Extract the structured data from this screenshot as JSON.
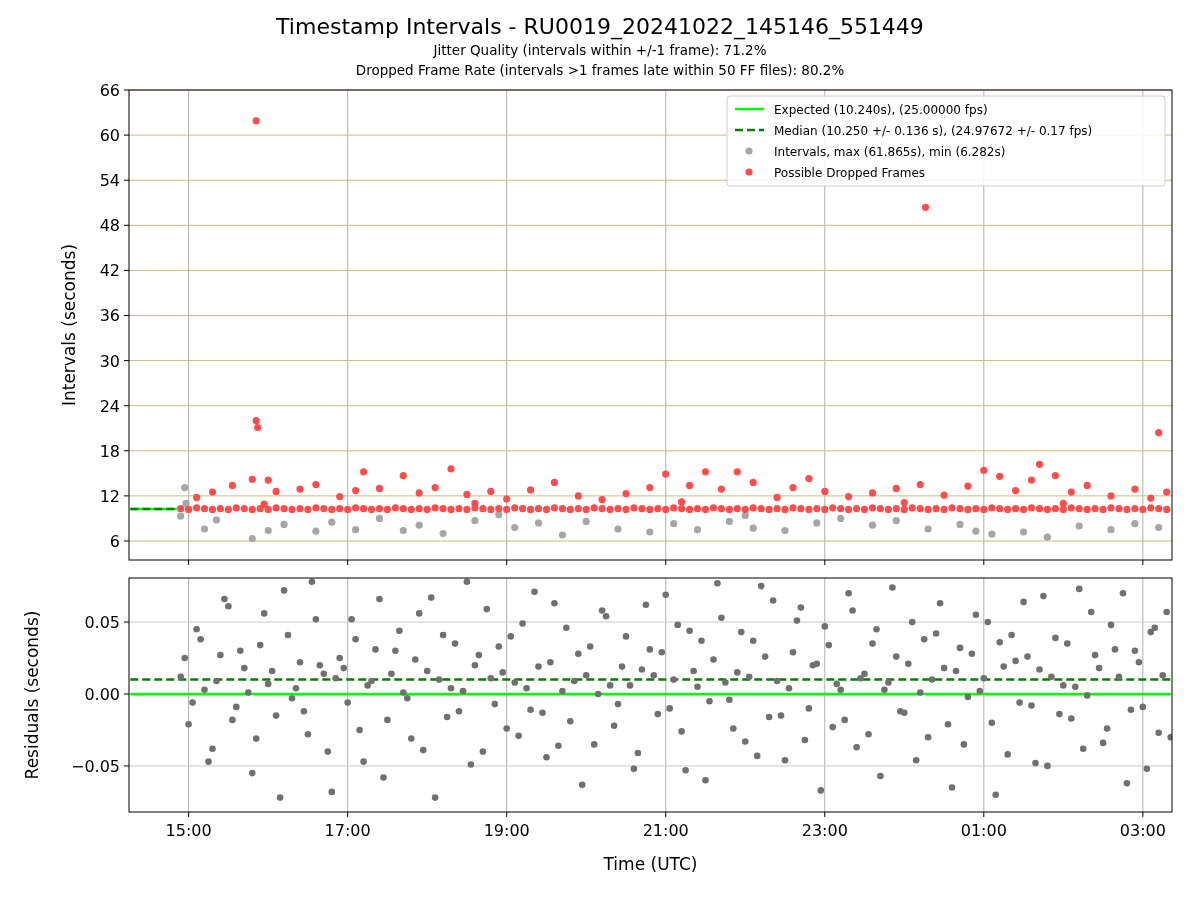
{
  "figure": {
    "title": "Timestamp Intervals - RU0019_20241022_145146_551449",
    "subtitles": [
      "Jitter Quality (intervals within +/-1 frame): 71.2%",
      "Dropped Frame Rate (intervals >1 frames late within 50 FF files): 80.2%"
    ]
  },
  "panels": [
    {
      "chart_data": {
        "type": "scatter",
        "ylabel": "Intervals (seconds)",
        "grid": true,
        "legend": true,
        "xlim": [
          "2024-10-22T14:15",
          "2024-10-23T03:22"
        ],
        "ylim": [
          3.47,
          66
        ],
        "yticks": [
          6,
          12,
          18,
          24,
          30,
          36,
          42,
          48,
          54,
          60,
          66
        ],
        "series": [
          {
            "name": "Expected (10.240s), (25.00000 fps)",
            "type": "line",
            "color": "#00ff00",
            "x": [
              "2024-10-22T14:16",
              "2024-10-22T14:51"
            ],
            "values": [
              10.24,
              10.24
            ]
          },
          {
            "name": "Median (10.250 +/- 0.136 s), (24.97672 +/- 0.17 fps)",
            "type": "line",
            "line_style": "dashed",
            "color": "#008000",
            "x": [
              "2024-10-22T14:16",
              "2024-10-22T14:51"
            ],
            "values": [
              10.25,
              10.25
            ]
          },
          {
            "name": "Intervals, max (61.865s), min (6.282s)",
            "color": "#a6a6a6",
            "x": [
              "2024-10-22T14:54",
              "2024-10-22T14:57",
              "2024-10-22T14:58",
              "2024-10-22T15:12",
              "2024-10-22T15:21",
              "2024-10-22T15:48",
              "2024-10-22T16:00",
              "2024-10-22T16:12",
              "2024-10-22T16:36",
              "2024-10-22T16:48",
              "2024-10-22T17:06",
              "2024-10-22T17:24",
              "2024-10-22T17:42",
              "2024-10-22T17:54",
              "2024-10-22T18:12",
              "2024-10-22T18:36",
              "2024-10-22T19:06",
              "2024-10-22T19:24",
              "2024-10-22T19:42",
              "2024-10-22T20:00",
              "2024-10-22T20:24",
              "2024-10-22T20:48",
              "2024-10-22T21:06",
              "2024-10-22T21:24",
              "2024-10-22T21:48",
              "2024-10-22T22:06",
              "2024-10-22T22:30",
              "2024-10-22T22:54",
              "2024-10-22T23:12",
              "2024-10-22T23:36",
              "2024-10-22T23:54",
              "2024-10-23T00:18",
              "2024-10-23T00:42",
              "2024-10-23T00:54",
              "2024-10-23T01:06",
              "2024-10-23T01:30",
              "2024-10-23T01:48",
              "2024-10-23T02:12",
              "2024-10-23T02:36",
              "2024-10-23T02:54",
              "2024-10-23T03:12",
              "2024-10-22T22:00",
              "2024-10-22T18:54"
            ],
            "values": [
              9.3,
              13.1,
              11.0,
              7.6,
              8.8,
              6.3,
              7.4,
              8.2,
              7.3,
              8.5,
              7.5,
              9.0,
              7.4,
              8.1,
              7.0,
              8.7,
              7.8,
              8.4,
              6.8,
              8.6,
              7.6,
              7.2,
              8.3,
              7.5,
              8.6,
              7.7,
              7.4,
              8.4,
              9.0,
              8.1,
              8.7,
              7.6,
              8.2,
              7.3,
              6.9,
              7.2,
              6.5,
              8.0,
              7.5,
              8.3,
              7.8,
              9.4,
              9.5
            ]
          },
          {
            "name": "Possible Dropped Frames",
            "color": "#ff4c4c",
            "x": [
              "2024-10-22T14:54",
              "2024-10-22T15:00",
              "2024-10-22T15:06",
              "2024-10-22T15:12",
              "2024-10-22T15:18",
              "2024-10-22T15:24",
              "2024-10-22T15:30",
              "2024-10-22T15:36",
              "2024-10-22T15:42",
              "2024-10-22T15:48",
              "2024-10-22T15:54",
              "2024-10-22T16:00",
              "2024-10-22T16:06",
              "2024-10-22T16:12",
              "2024-10-22T16:18",
              "2024-10-22T16:24",
              "2024-10-22T16:30",
              "2024-10-22T16:36",
              "2024-10-22T16:42",
              "2024-10-22T16:48",
              "2024-10-22T16:54",
              "2024-10-22T17:00",
              "2024-10-22T17:06",
              "2024-10-22T17:12",
              "2024-10-22T17:18",
              "2024-10-22T17:24",
              "2024-10-22T17:30",
              "2024-10-22T17:36",
              "2024-10-22T17:42",
              "2024-10-22T17:48",
              "2024-10-22T17:54",
              "2024-10-22T18:00",
              "2024-10-22T18:06",
              "2024-10-22T18:12",
              "2024-10-22T18:18",
              "2024-10-22T18:24",
              "2024-10-22T18:30",
              "2024-10-22T18:36",
              "2024-10-22T18:42",
              "2024-10-22T18:48",
              "2024-10-22T18:54",
              "2024-10-22T19:00",
              "2024-10-22T19:06",
              "2024-10-22T19:12",
              "2024-10-22T19:18",
              "2024-10-22T19:24",
              "2024-10-22T19:30",
              "2024-10-22T19:36",
              "2024-10-22T19:42",
              "2024-10-22T19:48",
              "2024-10-22T19:54",
              "2024-10-22T20:00",
              "2024-10-22T20:06",
              "2024-10-22T20:12",
              "2024-10-22T20:18",
              "2024-10-22T20:24",
              "2024-10-22T20:30",
              "2024-10-22T20:36",
              "2024-10-22T20:42",
              "2024-10-22T20:48",
              "2024-10-22T20:54",
              "2024-10-22T21:00",
              "2024-10-22T21:06",
              "2024-10-22T21:12",
              "2024-10-22T21:18",
              "2024-10-22T21:24",
              "2024-10-22T21:30",
              "2024-10-22T21:36",
              "2024-10-22T21:42",
              "2024-10-22T21:48",
              "2024-10-22T21:54",
              "2024-10-22T22:00",
              "2024-10-22T22:06",
              "2024-10-22T22:12",
              "2024-10-22T22:18",
              "2024-10-22T22:24",
              "2024-10-22T22:30",
              "2024-10-22T22:36",
              "2024-10-22T22:42",
              "2024-10-22T22:48",
              "2024-10-22T22:54",
              "2024-10-22T23:00",
              "2024-10-22T23:06",
              "2024-10-22T23:12",
              "2024-10-22T23:18",
              "2024-10-22T23:24",
              "2024-10-22T23:30",
              "2024-10-22T23:36",
              "2024-10-22T23:42",
              "2024-10-22T23:48",
              "2024-10-22T23:54",
              "2024-10-23T00:00",
              "2024-10-23T00:06",
              "2024-10-23T00:12",
              "2024-10-23T00:18",
              "2024-10-23T00:24",
              "2024-10-23T00:30",
              "2024-10-23T00:36",
              "2024-10-23T00:42",
              "2024-10-23T00:48",
              "2024-10-23T00:54",
              "2024-10-23T01:00",
              "2024-10-23T01:06",
              "2024-10-23T01:12",
              "2024-10-23T01:18",
              "2024-10-23T01:24",
              "2024-10-23T01:30",
              "2024-10-23T01:36",
              "2024-10-23T01:42",
              "2024-10-23T01:48",
              "2024-10-23T01:54",
              "2024-10-23T02:00",
              "2024-10-23T02:06",
              "2024-10-23T02:12",
              "2024-10-23T02:18",
              "2024-10-23T02:24",
              "2024-10-23T02:30",
              "2024-10-23T02:36",
              "2024-10-23T02:42",
              "2024-10-23T02:48",
              "2024-10-23T02:54",
              "2024-10-23T03:00",
              "2024-10-23T03:06",
              "2024-10-23T03:12",
              "2024-10-23T03:18",
              "2024-10-22T15:51",
              "2024-10-22T15:51",
              "2024-10-22T15:52",
              "2024-10-23T00:16",
              "2024-10-23T03:12",
              "2024-10-22T15:06",
              "2024-10-22T15:18",
              "2024-10-22T15:33",
              "2024-10-22T15:48",
              "2024-10-22T16:00",
              "2024-10-22T16:06",
              "2024-10-22T16:24",
              "2024-10-22T16:36",
              "2024-10-22T16:54",
              "2024-10-22T17:06",
              "2024-10-22T17:12",
              "2024-10-22T17:24",
              "2024-10-22T17:42",
              "2024-10-22T17:54",
              "2024-10-22T18:06",
              "2024-10-22T18:18",
              "2024-10-22T18:30",
              "2024-10-22T18:48",
              "2024-10-22T19:00",
              "2024-10-22T19:18",
              "2024-10-22T19:36",
              "2024-10-22T19:54",
              "2024-10-22T20:12",
              "2024-10-22T20:30",
              "2024-10-22T20:48",
              "2024-10-22T21:00",
              "2024-10-22T21:18",
              "2024-10-22T21:30",
              "2024-10-22T21:42",
              "2024-10-22T21:54",
              "2024-10-22T22:06",
              "2024-10-22T22:24",
              "2024-10-22T22:36",
              "2024-10-22T22:48",
              "2024-10-22T23:00",
              "2024-10-22T23:18",
              "2024-10-22T23:36",
              "2024-10-22T23:54",
              "2024-10-23T00:12",
              "2024-10-23T00:30",
              "2024-10-23T00:48",
              "2024-10-23T01:00",
              "2024-10-23T01:12",
              "2024-10-23T01:24",
              "2024-10-23T01:36",
              "2024-10-23T01:42",
              "2024-10-23T01:54",
              "2024-10-23T02:06",
              "2024-10-23T02:18",
              "2024-10-23T02:36",
              "2024-10-23T02:54",
              "2024-10-23T03:06",
              "2024-10-23T03:18",
              "2024-10-22T15:57",
              "2024-10-22T18:36",
              "2024-10-22T21:12",
              "2024-10-23T00:00",
              "2024-10-23T02:00"
            ],
            "values": [
              10.3,
              10.2,
              10.4,
              10.3,
              10.2,
              10.3,
              10.2,
              10.4,
              10.3,
              10.2,
              10.3,
              10.2,
              10.4,
              10.3,
              10.2,
              10.3,
              10.2,
              10.4,
              10.3,
              10.2,
              10.3,
              10.2,
              10.4,
              10.3,
              10.2,
              10.3,
              10.2,
              10.4,
              10.3,
              10.2,
              10.3,
              10.2,
              10.4,
              10.3,
              10.2,
              10.3,
              10.2,
              10.4,
              10.3,
              10.2,
              10.3,
              10.2,
              10.4,
              10.3,
              10.2,
              10.3,
              10.2,
              10.4,
              10.3,
              10.2,
              10.3,
              10.2,
              10.4,
              10.3,
              10.2,
              10.3,
              10.2,
              10.4,
              10.3,
              10.2,
              10.3,
              10.2,
              10.4,
              10.3,
              10.2,
              10.3,
              10.2,
              10.4,
              10.3,
              10.2,
              10.3,
              10.2,
              10.4,
              10.3,
              10.2,
              10.3,
              10.2,
              10.4,
              10.3,
              10.2,
              10.3,
              10.2,
              10.4,
              10.3,
              10.2,
              10.3,
              10.2,
              10.4,
              10.3,
              10.2,
              10.3,
              10.2,
              10.4,
              10.3,
              10.2,
              10.3,
              10.2,
              10.4,
              10.3,
              10.2,
              10.3,
              10.2,
              10.4,
              10.3,
              10.2,
              10.3,
              10.2,
              10.4,
              10.3,
              10.2,
              10.3,
              10.2,
              10.4,
              10.3,
              10.2,
              10.3,
              10.2,
              10.4,
              10.3,
              10.2,
              10.3,
              10.2,
              10.4,
              10.3,
              10.2,
              61.9,
              22.0,
              21.1,
              50.4,
              20.4,
              11.8,
              12.5,
              13.4,
              14.2,
              14.1,
              12.6,
              12.9,
              13.5,
              11.9,
              12.7,
              15.2,
              13.0,
              14.7,
              12.4,
              13.1,
              15.6,
              12.2,
              12.6,
              11.6,
              12.8,
              13.8,
              12.0,
              11.5,
              12.3,
              13.1,
              14.9,
              13.4,
              15.2,
              12.9,
              15.2,
              13.8,
              11.8,
              13.1,
              14.3,
              12.6,
              11.9,
              12.4,
              13.0,
              13.5,
              12.1,
              13.3,
              15.4,
              14.6,
              12.7,
              14.1,
              16.2,
              14.7,
              12.5,
              13.4,
              12.0,
              12.9,
              11.7,
              12.5,
              10.9,
              11.0,
              11.2,
              11.1,
              11.0
            ]
          }
        ]
      }
    },
    {
      "chart_data": {
        "type": "scatter",
        "xlabel": "Time (UTC)",
        "ylabel": "Residuals (seconds)",
        "grid": true,
        "xlim": [
          "2024-10-22T14:15",
          "2024-10-23T03:22"
        ],
        "ylim": [
          -0.082,
          0.0806
        ],
        "xticks": [
          {
            "value": "2024-10-22T15:00",
            "label": "15:00"
          },
          {
            "value": "2024-10-22T17:00",
            "label": "17:00"
          },
          {
            "value": "2024-10-22T19:00",
            "label": "19:00"
          },
          {
            "value": "2024-10-22T21:00",
            "label": "21:00"
          },
          {
            "value": "2024-10-22T23:00",
            "label": "23:00"
          },
          {
            "value": "2024-10-23T01:00",
            "label": "01:00"
          },
          {
            "value": "2024-10-23T03:00",
            "label": "03:00"
          }
        ],
        "yticks": [
          {
            "value": -0.05,
            "label": "−0.05"
          },
          {
            "value": 0,
            "label": "0.00"
          },
          {
            "value": 0.05,
            "label": "0.05"
          }
        ],
        "series": [
          {
            "type": "line",
            "color": "#00ff00",
            "x": [
              "2024-10-22T14:16",
              "2024-10-23T03:21"
            ],
            "values": [
              0,
              0
            ]
          },
          {
            "type": "line",
            "line_style": "dashed",
            "color": "#008000",
            "x": [
              "2024-10-22T14:16",
              "2024-10-23T03:21"
            ],
            "values": [
              0.01,
              0.01
            ]
          },
          {
            "color": "#707070",
            "x": [
              "2024-10-22T14:54",
              "2024-10-22T15:00",
              "2024-10-22T15:06",
              "2024-10-22T15:12",
              "2024-10-22T15:18",
              "2024-10-22T15:24",
              "2024-10-22T15:30",
              "2024-10-22T15:36",
              "2024-10-22T15:42",
              "2024-10-22T15:48",
              "2024-10-22T15:54",
              "2024-10-22T16:00",
              "2024-10-22T16:06",
              "2024-10-22T16:12",
              "2024-10-22T16:18",
              "2024-10-22T16:24",
              "2024-10-22T16:30",
              "2024-10-22T16:36",
              "2024-10-22T16:42",
              "2024-10-22T16:48",
              "2024-10-22T16:54",
              "2024-10-22T17:00",
              "2024-10-22T17:06",
              "2024-10-22T17:12",
              "2024-10-22T17:18",
              "2024-10-22T17:24",
              "2024-10-22T17:30",
              "2024-10-22T17:36",
              "2024-10-22T17:42",
              "2024-10-22T17:48",
              "2024-10-22T17:54",
              "2024-10-22T18:00",
              "2024-10-22T18:06",
              "2024-10-22T18:12",
              "2024-10-22T18:18",
              "2024-10-22T18:24",
              "2024-10-22T18:30",
              "2024-10-22T18:36",
              "2024-10-22T18:42",
              "2024-10-22T18:48",
              "2024-10-22T18:54",
              "2024-10-22T19:00",
              "2024-10-22T19:06",
              "2024-10-22T19:12",
              "2024-10-22T19:18",
              "2024-10-22T19:24",
              "2024-10-22T19:30",
              "2024-10-22T19:36",
              "2024-10-22T19:42",
              "2024-10-22T19:48",
              "2024-10-22T19:54",
              "2024-10-22T20:00",
              "2024-10-22T20:06",
              "2024-10-22T20:12",
              "2024-10-22T20:18",
              "2024-10-22T20:24",
              "2024-10-22T20:30",
              "2024-10-22T20:36",
              "2024-10-22T20:42",
              "2024-10-22T20:48",
              "2024-10-22T20:54",
              "2024-10-22T21:00",
              "2024-10-22T21:06",
              "2024-10-22T21:12",
              "2024-10-22T21:18",
              "2024-10-22T21:24",
              "2024-10-22T21:30",
              "2024-10-22T21:36",
              "2024-10-22T21:42",
              "2024-10-22T21:48",
              "2024-10-22T21:54",
              "2024-10-22T22:00",
              "2024-10-22T22:06",
              "2024-10-22T22:12",
              "2024-10-22T22:18",
              "2024-10-22T22:24",
              "2024-10-22T22:30",
              "2024-10-22T22:36",
              "2024-10-22T22:42",
              "2024-10-22T22:48",
              "2024-10-22T22:54",
              "2024-10-22T23:00",
              "2024-10-22T23:06",
              "2024-10-22T23:12",
              "2024-10-22T23:18",
              "2024-10-22T23:24",
              "2024-10-22T23:30",
              "2024-10-22T23:36",
              "2024-10-22T23:42",
              "2024-10-22T23:48",
              "2024-10-22T23:54",
              "2024-10-23T00:00",
              "2024-10-23T00:06",
              "2024-10-23T00:12",
              "2024-10-23T00:18",
              "2024-10-23T00:24",
              "2024-10-23T00:30",
              "2024-10-23T00:36",
              "2024-10-23T00:42",
              "2024-10-23T00:48",
              "2024-10-23T00:54",
              "2024-10-23T01:00",
              "2024-10-23T01:06",
              "2024-10-23T01:12",
              "2024-10-23T01:18",
              "2024-10-23T01:24",
              "2024-10-23T01:30",
              "2024-10-23T01:36",
              "2024-10-23T01:42",
              "2024-10-23T01:48",
              "2024-10-23T01:54",
              "2024-10-23T02:00",
              "2024-10-23T02:06",
              "2024-10-23T02:12",
              "2024-10-23T02:18",
              "2024-10-23T02:24",
              "2024-10-23T02:30",
              "2024-10-23T02:36",
              "2024-10-23T02:42",
              "2024-10-23T02:48",
              "2024-10-23T02:54",
              "2024-10-23T03:00",
              "2024-10-23T03:06",
              "2024-10-23T03:12",
              "2024-10-23T03:18",
              "2024-10-22T14:57",
              "2024-10-22T15:03",
              "2024-10-22T15:09",
              "2024-10-22T15:15",
              "2024-10-22T15:21",
              "2024-10-22T15:27",
              "2024-10-22T15:33",
              "2024-10-22T15:39",
              "2024-10-22T15:45",
              "2024-10-22T15:51",
              "2024-10-22T15:57",
              "2024-10-22T16:03",
              "2024-10-22T16:09",
              "2024-10-22T16:15",
              "2024-10-22T16:21",
              "2024-10-22T16:27",
              "2024-10-22T16:33",
              "2024-10-22T16:39",
              "2024-10-22T16:45",
              "2024-10-22T16:51",
              "2024-10-22T16:57",
              "2024-10-22T17:03",
              "2024-10-22T17:09",
              "2024-10-22T17:15",
              "2024-10-22T17:21",
              "2024-10-22T17:27",
              "2024-10-22T17:33",
              "2024-10-22T17:39",
              "2024-10-22T17:45",
              "2024-10-22T17:51",
              "2024-10-22T17:57",
              "2024-10-22T18:03",
              "2024-10-22T18:09",
              "2024-10-22T18:15",
              "2024-10-22T18:21",
              "2024-10-22T18:27",
              "2024-10-22T18:33",
              "2024-10-22T18:39",
              "2024-10-22T18:45",
              "2024-10-22T18:51",
              "2024-10-22T18:57",
              "2024-10-22T19:03",
              "2024-10-22T19:09",
              "2024-10-22T19:15",
              "2024-10-22T19:21",
              "2024-10-22T19:27",
              "2024-10-22T19:33",
              "2024-10-22T19:39",
              "2024-10-22T19:45",
              "2024-10-22T19:51",
              "2024-10-22T19:57",
              "2024-10-22T20:03",
              "2024-10-22T20:09",
              "2024-10-22T20:15",
              "2024-10-22T20:21",
              "2024-10-22T20:27",
              "2024-10-22T20:33",
              "2024-10-22T20:39",
              "2024-10-22T20:45",
              "2024-10-22T20:51",
              "2024-10-22T20:57",
              "2024-10-22T21:03",
              "2024-10-22T21:09",
              "2024-10-22T21:15",
              "2024-10-22T21:21",
              "2024-10-22T21:27",
              "2024-10-22T21:33",
              "2024-10-22T21:39",
              "2024-10-22T21:45",
              "2024-10-22T21:51",
              "2024-10-22T21:57",
              "2024-10-22T22:03",
              "2024-10-22T22:09",
              "2024-10-22T22:15",
              "2024-10-22T22:21",
              "2024-10-22T22:27",
              "2024-10-22T22:33",
              "2024-10-22T22:39",
              "2024-10-22T22:45",
              "2024-10-22T22:51",
              "2024-10-22T22:57",
              "2024-10-22T23:03",
              "2024-10-22T23:09",
              "2024-10-22T23:15",
              "2024-10-22T23:21",
              "2024-10-22T23:27",
              "2024-10-22T23:33",
              "2024-10-22T23:39",
              "2024-10-22T23:45",
              "2024-10-22T23:51",
              "2024-10-22T23:57",
              "2024-10-23T00:03",
              "2024-10-23T00:09",
              "2024-10-23T00:15",
              "2024-10-23T00:21",
              "2024-10-23T00:27",
              "2024-10-23T00:33",
              "2024-10-23T00:39",
              "2024-10-23T00:45",
              "2024-10-23T00:51",
              "2024-10-23T00:57",
              "2024-10-23T01:03",
              "2024-10-23T01:09",
              "2024-10-23T01:15",
              "2024-10-23T01:21",
              "2024-10-23T01:27",
              "2024-10-23T01:33",
              "2024-10-23T01:39",
              "2024-10-23T01:45",
              "2024-10-23T01:51",
              "2024-10-23T01:57",
              "2024-10-23T02:03",
              "2024-10-23T02:09",
              "2024-10-23T02:15",
              "2024-10-23T02:21",
              "2024-10-23T02:27",
              "2024-10-23T02:33",
              "2024-10-23T02:39",
              "2024-10-23T02:45",
              "2024-10-23T02:51",
              "2024-10-23T02:57",
              "2024-10-23T03:03",
              "2024-10-23T03:09",
              "2024-10-23T03:15",
              "2024-10-23T03:21"
            ],
            "values": [
              0.012,
              -0.021,
              0.045,
              0.003,
              -0.038,
              0.027,
              0.061,
              -0.009,
              0.018,
              -0.055,
              0.034,
              0.007,
              -0.015,
              0.072,
              -0.003,
              0.022,
              -0.028,
              0.052,
              0.014,
              -0.068,
              0.025,
              -0.006,
              0.038,
              -0.047,
              0.009,
              0.066,
              -0.018,
              0.03,
              0.001,
              -0.031,
              0.056,
              0.016,
              -0.072,
              0.041,
              0.004,
              -0.012,
              0.078,
              0.02,
              -0.04,
              0.011,
              0.033,
              -0.024,
              0.008,
              0.049,
              -0.011,
              0.019,
              -0.044,
              0.063,
              0.002,
              -0.019,
              0.028,
              0.013,
              -0.035,
              0.058,
              0.006,
              -0.007,
              0.04,
              -0.052,
              0.017,
              0.031,
              -0.014,
              0.069,
              0.01,
              -0.026,
              0.044,
              0.005,
              -0.06,
              0.024,
              0.053,
              -0.004,
              0.015,
              -0.033,
              0.037,
              0.075,
              -0.016,
              0.009,
              -0.046,
              0.029,
              0.06,
              -0.01,
              0.021,
              0.047,
              -0.023,
              0.003,
              0.07,
              -0.037,
              0.014,
              0.035,
              -0.057,
              0.008,
              0.026,
              -0.013,
              0.05,
              0.001,
              -0.03,
              0.042,
              0.018,
              -0.065,
              0.032,
              -0.002,
              0.055,
              0.011,
              -0.02,
              0.036,
              -0.042,
              0.023,
              0.064,
              -0.008,
              0.017,
              -0.05,
              0.039,
              0.006,
              -0.017,
              0.073,
              -0.001,
              0.027,
              -0.034,
              0.048,
              0.012,
              -0.062,
              0.03,
              -0.009,
              0.043,
              -0.027,
              0.057,
              0.025,
              -0.006,
              0.038,
              -0.047,
              0.009,
              0.066,
              -0.018,
              0.03,
              0.001,
              -0.031,
              0.056,
              0.016,
              -0.072,
              0.041,
              0.004,
              -0.012,
              0.078,
              0.02,
              -0.04,
              0.011,
              0.018,
              0.052,
              -0.025,
              0.006,
              0.031,
              -0.058,
              0.014,
              0.044,
              -0.003,
              0.024,
              -0.039,
              0.067,
              0.01,
              -0.016,
              0.035,
              0.002,
              -0.049,
              0.027,
              0.059,
              -0.007,
              0.015,
              0.04,
              -0.029,
              0.004,
              0.071,
              -0.013,
              0.022,
              -0.036,
              0.046,
              0.009,
              -0.063,
              0.033,
              0.0,
              0.054,
              -0.022,
              0.019,
              0.006,
              -0.041,
              0.062,
              0.013,
              0.029,
              -0.01,
              0.048,
              -0.053,
              0.016,
              0.037,
              -0.005,
              0.077,
              0.008,
              -0.024,
              0.043,
              0.012,
              -0.043,
              0.026,
              0.065,
              -0.015,
              0.004,
              0.051,
              -0.032,
              0.02,
              -0.067,
              0.034,
              0.007,
              -0.018,
              0.058,
              0.011,
              -0.028,
              0.045,
              0.003,
              0.074,
              -0.012,
              0.021,
              -0.046,
              0.038,
              0.01,
              0.063,
              -0.021,
              0.016,
              -0.035,
              0.028,
              0.002,
              0.05,
              -0.07,
              0.019,
              0.041,
              -0.006,
              0.026,
              -0.048,
              0.068,
              0.012,
              -0.014,
              0.035,
              0.005,
              -0.038,
              0.057,
              0.018,
              -0.024,
              0.031,
              0.07,
              -0.011,
              0.022,
              -0.052,
              0.046,
              0.013,
              -0.03
            ]
          }
        ]
      }
    }
  ]
}
